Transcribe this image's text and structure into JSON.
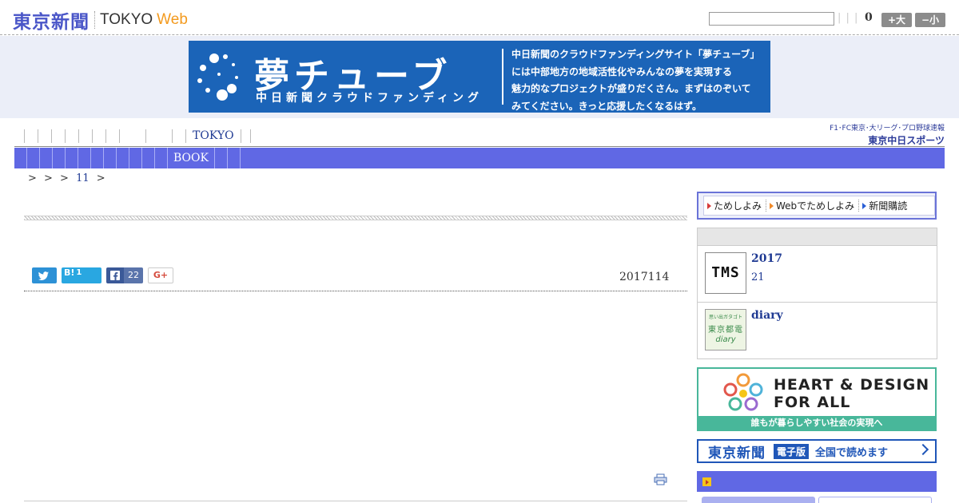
{
  "header": {
    "logo_jp": "東京新聞",
    "logo_tokyo": "TOKYO",
    "logo_web": "Web",
    "search_pipes": "| | |",
    "font_size_value": "0",
    "btn_large": "+大",
    "btn_small": "−小"
  },
  "ad_banner": {
    "title": "夢チューブ",
    "subtitle": "中日新聞クラウドファンディング",
    "desc_lines": [
      "中日新聞のクラウドファンディングサイト「夢チューブ」",
      "には中部地方の地域活性化やみんなの夢を実現する",
      "魅力的なプロジェクトが盛りだくさん。まずはのぞいて",
      "みてください。きっと応援したくなるはず。"
    ]
  },
  "global_nav": {
    "label_tokyo": "TOKYO"
  },
  "chunichi_logo": {
    "line1": "F1･FC東京･大リーグ･プロ野球速報",
    "line2": "東京中日スポーツ"
  },
  "sub_nav": {
    "label_book": "BOOK"
  },
  "breadcrumb": {
    "seps": "> > >",
    "link": "11",
    "end": ">"
  },
  "article": {
    "date": "2017114",
    "hatena_label": "B!",
    "hatena_count": "1",
    "facebook_count": "22",
    "googleplus_label": "G+"
  },
  "sidebar": {
    "subscribe": {
      "item1": "ためしよみ",
      "item2": "Webでためしよみ",
      "item3": "新聞購読"
    },
    "list": [
      {
        "thumb": "TMS",
        "title": "2017",
        "sub": "21"
      },
      {
        "thumb_lines": [
          "思い出ガタゴト",
          "東京都電",
          "diary"
        ],
        "title": "diary"
      }
    ],
    "heart_design": {
      "title_line1": "HEART & DESIGN",
      "title_line2": "FOR ALL",
      "footer": "誰もが暮らしやすい社会の実現へ"
    },
    "edigital": {
      "logo": "東京新聞",
      "badge": "電子版",
      "text": "全国で読めます"
    }
  },
  "colors": {
    "nav_purple": "#6068e4",
    "ad_blue": "#1b64b8",
    "web_orange": "#f39a1e",
    "heart_green": "#48b79a"
  }
}
